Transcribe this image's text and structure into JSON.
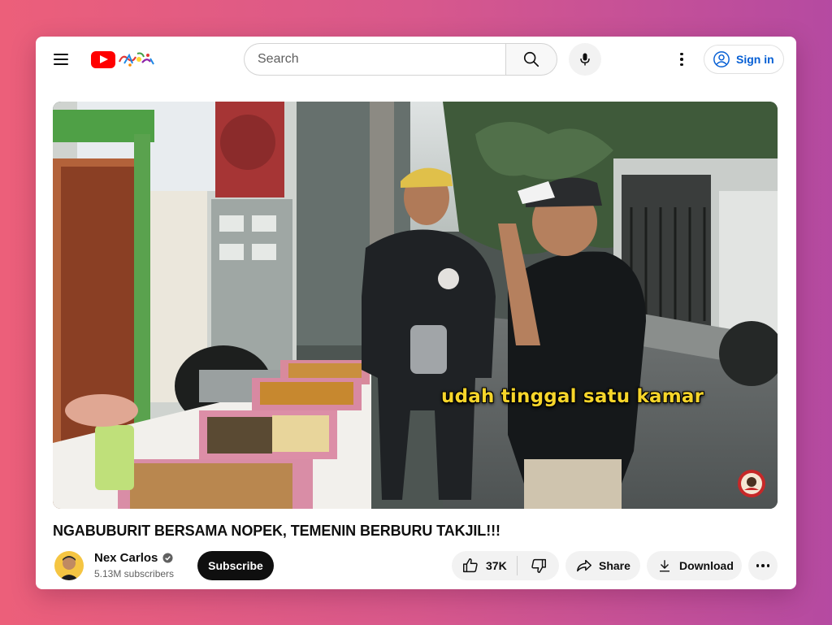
{
  "header": {
    "search_placeholder": "Search",
    "sign_in_label": "Sign in"
  },
  "video": {
    "subtitle_text": "udah tinggal satu kamar",
    "title": "NGABUBURIT BERSAMA NOPEK, TEMENIN BERBURU TAKJIL!!!"
  },
  "channel": {
    "name": "Nex Carlos",
    "subscribers": "5.13M subscribers",
    "verified": true,
    "subscribe_label": "Subscribe"
  },
  "actions": {
    "like_count": "37K",
    "share_label": "Share",
    "download_label": "Download"
  },
  "colors": {
    "brand_red": "#ff0000",
    "link_blue": "#065fd4",
    "subtitle_yellow": "#f6d52a",
    "background_gradient": [
      "#ec5f7a",
      "#b54aa1"
    ]
  },
  "icons": {
    "menu": "hamburger-icon",
    "logo": "youtube-logo",
    "search": "search-icon",
    "mic": "mic-icon",
    "more": "more-vert-icon",
    "account": "account-circle-icon",
    "like": "thumb-up-icon",
    "dislike": "thumb-down-icon",
    "share": "share-arrow-icon",
    "download": "download-icon",
    "verified": "verified-check-icon"
  }
}
